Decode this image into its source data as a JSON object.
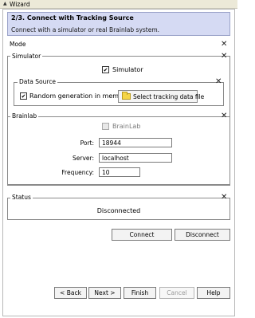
{
  "window": {
    "title": "Wizard",
    "collapse_icon": "triangle-up-icon"
  },
  "step": {
    "title": "2/3. Connect with Tracking Source",
    "description": "Connect with a simulator or real Brainlab system."
  },
  "mode": {
    "label": "Mode"
  },
  "simulator": {
    "label": "Simulator",
    "checkbox_label": "Simulator",
    "checked": true
  },
  "data_source": {
    "label": "Data Source",
    "random_label": "Random generation in memory",
    "random_checked": true,
    "select_button_label": "Select tracking data file",
    "select_icon": "folder-icon"
  },
  "brainlab": {
    "label": "Brainlab",
    "checkbox_label": "BrainLab",
    "checked": false,
    "port_label": "Port:",
    "port_value": "18944",
    "server_label": "Server:",
    "server_value": "localhost",
    "frequency_label": "Frequency:",
    "frequency_value": "10"
  },
  "status": {
    "label": "Status",
    "text": "Disconnected"
  },
  "connection": {
    "connect_label": "Connect",
    "disconnect_label": "Disconnect"
  },
  "nav": {
    "back_label": "< Back",
    "next_label": "Next >",
    "finish_label": "Finish",
    "cancel_label": "Cancel",
    "help_label": "Help"
  },
  "close_glyph": "✕",
  "colors": {
    "step_header_bg": "#d5daf3",
    "folder": "#f5d547"
  }
}
